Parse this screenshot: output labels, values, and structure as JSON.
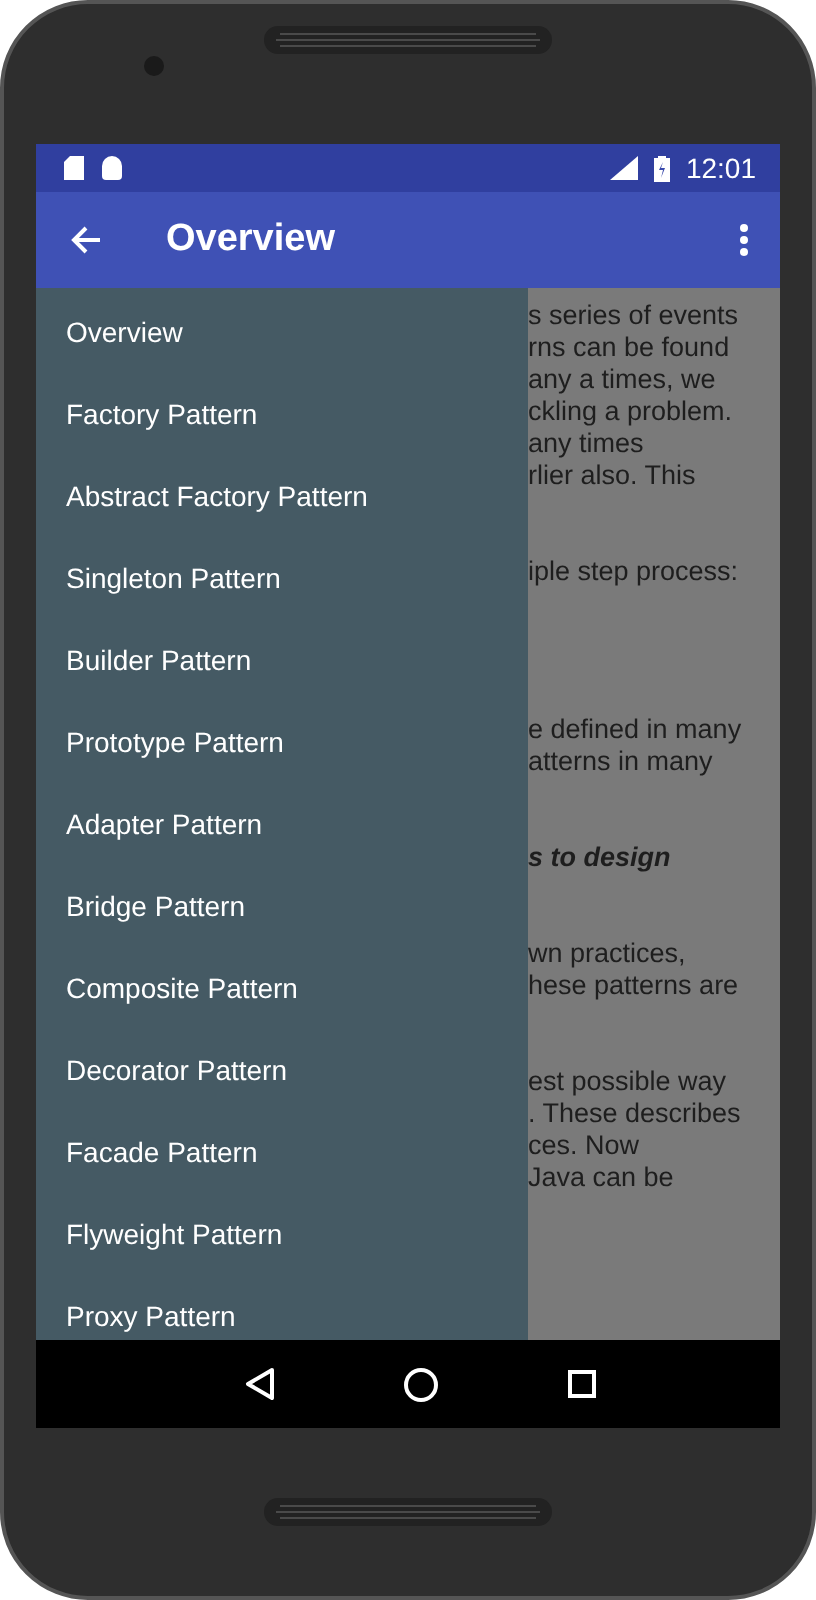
{
  "status_bar": {
    "time": "12:01"
  },
  "app_bar": {
    "title": "Overview"
  },
  "content": {
    "paragraphs": [
      {
        "lines": [
          "s series of events",
          "rns can be found",
          "any a times, we",
          "ckling a problem.",
          "any times",
          "rlier also. This"
        ],
        "emphasis": false
      },
      {
        "lines": [
          "iple step process:"
        ],
        "emphasis": false
      },
      {
        "lines": [
          "e defined in many",
          "atterns in many"
        ],
        "emphasis": false
      },
      {
        "lines": [
          "s to design"
        ],
        "emphasis": true
      },
      {
        "lines": [
          "wn practices,",
          "hese patterns are"
        ],
        "emphasis": false
      },
      {
        "lines": [
          "est possible way",
          ". These describes",
          "ces. Now",
          "Java can be"
        ],
        "emphasis": false
      }
    ]
  },
  "drawer": {
    "items": [
      {
        "label": "Overview"
      },
      {
        "label": "Factory Pattern"
      },
      {
        "label": "Abstract Factory Pattern"
      },
      {
        "label": "Singleton Pattern"
      },
      {
        "label": "Builder Pattern"
      },
      {
        "label": "Prototype Pattern"
      },
      {
        "label": "Adapter Pattern"
      },
      {
        "label": "Bridge Pattern"
      },
      {
        "label": "Composite Pattern"
      },
      {
        "label": "Decorator Pattern"
      },
      {
        "label": "Facade Pattern"
      },
      {
        "label": "Flyweight Pattern"
      },
      {
        "label": "Proxy Pattern"
      }
    ]
  }
}
